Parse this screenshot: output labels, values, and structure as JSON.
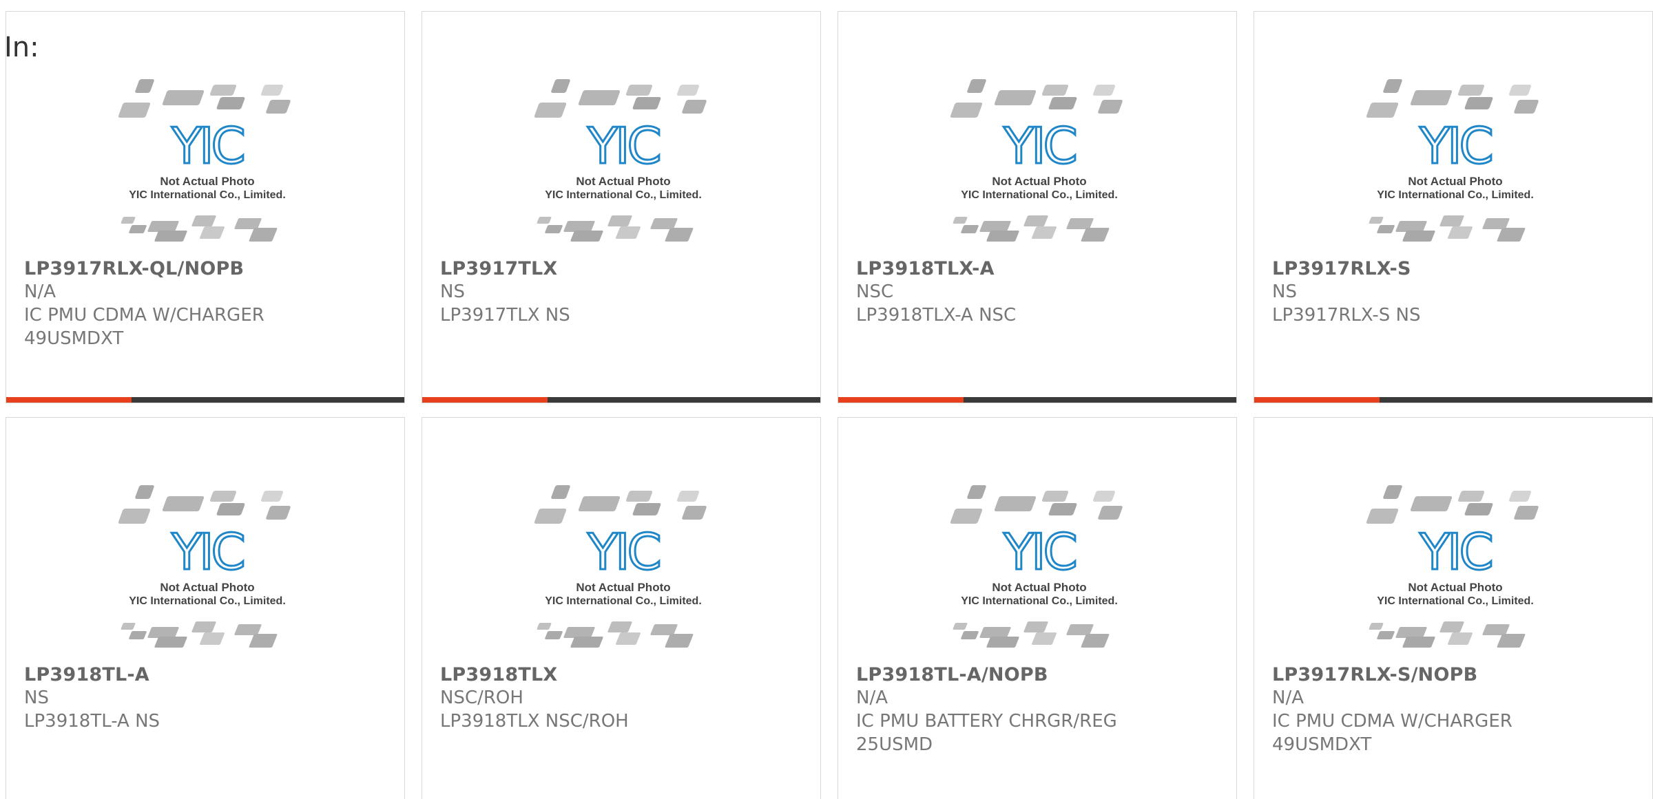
{
  "filter_label": "In:",
  "placeholder_image": {
    "caption_line1": "Not Actual Photo",
    "caption_line2": "YIC International Co., Limited.",
    "logo_text": "YIC"
  },
  "colors": {
    "accent": "#e8401c",
    "bar": "#3a3a3a",
    "logo": "#1f86c8",
    "text": "#777777"
  },
  "products": [
    {
      "part": "LP3917RLX-QL/NOPB",
      "manufacturer": "N/A",
      "description": "IC PMU CDMA W/CHARGER",
      "extra": "49USMDXT"
    },
    {
      "part": "LP3917TLX",
      "manufacturer": "NS",
      "description": "LP3917TLX NS",
      "extra": ""
    },
    {
      "part": "LP3918TLX-A",
      "manufacturer": "NSC",
      "description": "LP3918TLX-A NSC",
      "extra": ""
    },
    {
      "part": "LP3917RLX-S",
      "manufacturer": "NS",
      "description": "LP3917RLX-S NS",
      "extra": ""
    },
    {
      "part": "LP3918TL-A",
      "manufacturer": "NS",
      "description": "LP3918TL-A NS",
      "extra": ""
    },
    {
      "part": "LP3918TLX",
      "manufacturer": "NSC/ROH",
      "description": "LP3918TLX NSC/ROH",
      "extra": ""
    },
    {
      "part": "LP3918TL-A/NOPB",
      "manufacturer": "N/A",
      "description": "IC PMU BATTERY CHRGR/REG",
      "extra": "25USMD"
    },
    {
      "part": "LP3917RLX-S/NOPB",
      "manufacturer": "N/A",
      "description": "IC PMU CDMA W/CHARGER",
      "extra": "49USMDXT"
    }
  ]
}
